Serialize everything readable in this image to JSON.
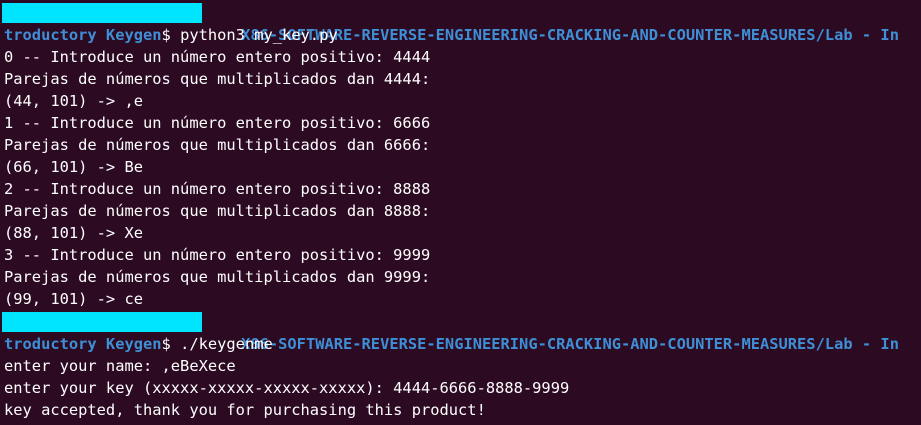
{
  "prompts": [
    {
      "path_line1": "X86-SOFTWARE-REVERSE-ENGINEERING-CRACKING-AND-COUNTER-MEASURES/Lab - In",
      "path_line2": "troductory Keygen",
      "symbol": "$ ",
      "command": "python3 my_key.py"
    },
    {
      "path_line1": "X86-SOFTWARE-REVERSE-ENGINEERING-CRACKING-AND-COUNTER-MEASURES/Lab - In",
      "path_line2": "troductory Keygen",
      "symbol": "$ ",
      "command": "./keygenme"
    }
  ],
  "python_output": [
    "0 -- Introduce un número entero positivo: 4444",
    "Parejas de números que multiplicados dan 4444:",
    "(44, 101) -> ,e",
    "1 -- Introduce un número entero positivo: 6666",
    "Parejas de números que multiplicados dan 6666:",
    "(66, 101) -> Be",
    "2 -- Introduce un número entero positivo: 8888",
    "Parejas de números que multiplicados dan 8888:",
    "(88, 101) -> Xe",
    "3 -- Introduce un número entero positivo: 9999",
    "Parejas de números que multiplicados dan 9999:",
    "(99, 101) -> ce"
  ],
  "keygen_output": [
    "enter your name: ,eBeXece",
    "enter your key (xxxxx-xxxxx-xxxxx-xxxxx): 4444-6666-8888-9999",
    "key accepted, thank you for purchasing this product!"
  ],
  "colors": {
    "background": "#2c0a22",
    "text": "#ffffff",
    "path": "#3e8fd6",
    "redaction": "#00e5ff"
  }
}
